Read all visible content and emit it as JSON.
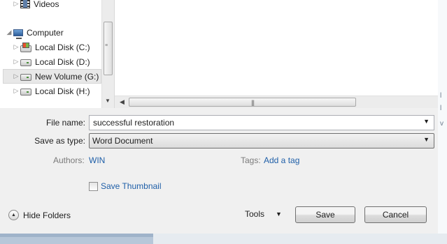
{
  "nav_tree": {
    "items": [
      {
        "label": "Videos",
        "icon": "film-icon",
        "arrow": "▷"
      },
      {
        "label": "Computer",
        "icon": "computer-icon",
        "arrow": "◢"
      },
      {
        "label": "Local Disk (C:)",
        "icon": "system-drive-icon",
        "arrow": "▷"
      },
      {
        "label": "Local Disk (D:)",
        "icon": "drive-icon",
        "arrow": "▷"
      },
      {
        "label": "New Volume (G:)",
        "icon": "drive-icon",
        "arrow": "▷",
        "selected": true
      },
      {
        "label": "Local Disk (H:)",
        "icon": "drive-icon",
        "arrow": "▷"
      }
    ]
  },
  "form": {
    "file_name_label": "File name:",
    "file_name_value": "successful restoration",
    "save_as_type_label": "Save as type:",
    "save_as_type_value": "Word Document",
    "authors_label": "Authors:",
    "authors_value": "WIN",
    "tags_label": "Tags:",
    "tags_value": "Add a tag",
    "save_thumbnail_label": "Save Thumbnail",
    "save_thumbnail_checked": false
  },
  "footer": {
    "hide_folders_label": "Hide Folders",
    "tools_label": "Tools",
    "save_label": "Save",
    "cancel_label": "Cancel"
  },
  "colors": {
    "link": "#1f5fa8",
    "dialog_bg": "#f0f0f0",
    "pane_bg": "#ffffff"
  }
}
